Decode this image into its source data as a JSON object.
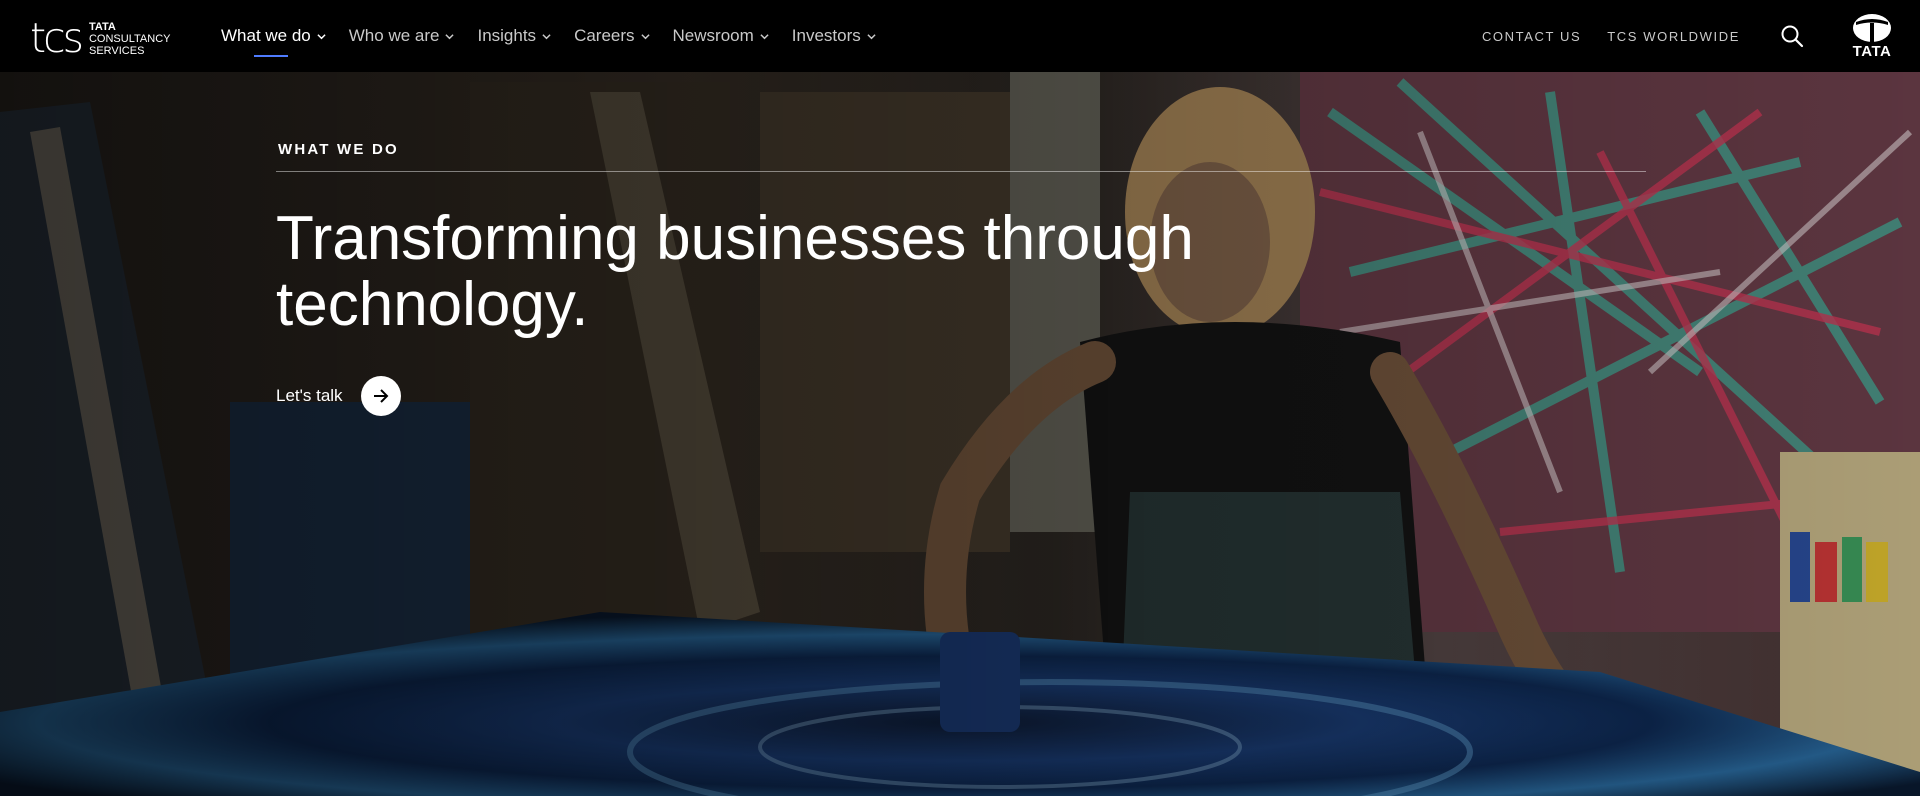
{
  "brand": {
    "logo_mark": "tcs",
    "logo_lines": [
      "TATA",
      "CONSULTANCY",
      "SERVICES"
    ],
    "group_logo_text": "TATA"
  },
  "nav": {
    "items": [
      {
        "label": "What we do",
        "active": true
      },
      {
        "label": "Who we are",
        "active": false
      },
      {
        "label": "Insights",
        "active": false
      },
      {
        "label": "Careers",
        "active": false
      },
      {
        "label": "Newsroom",
        "active": false
      },
      {
        "label": "Investors",
        "active": false
      }
    ],
    "accent_color": "#4f7cff"
  },
  "utility": {
    "contact_label": "CONTACT US",
    "worldwide_label": "TCS WORLDWIDE",
    "search_icon": "search-icon"
  },
  "hero": {
    "eyebrow": "WHAT WE DO",
    "headline_line1": "Transforming businesses through",
    "headline_line2": "technology.",
    "cta_label": "Let's talk",
    "cta_icon": "arrow-right-icon",
    "background": "artist painting a large blue abstract canvas in a studio"
  }
}
